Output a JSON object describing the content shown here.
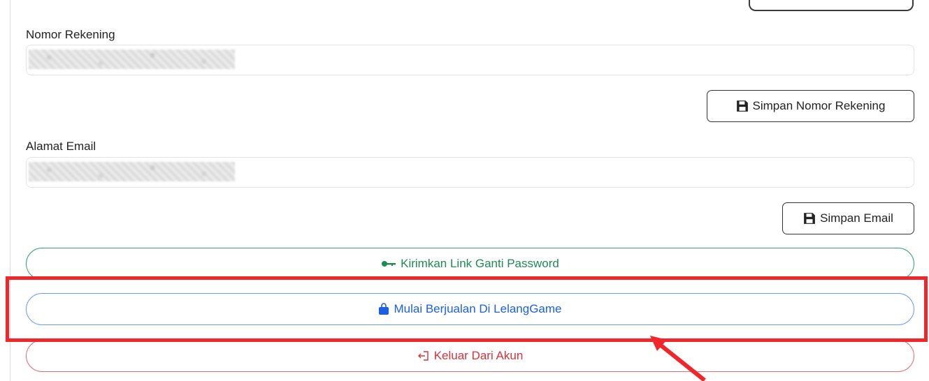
{
  "account_number": {
    "label": "Nomor Rekening",
    "save_label": "Simpan Nomor Rekening"
  },
  "email": {
    "label": "Alamat Email",
    "save_label": "Simpan Email"
  },
  "actions": {
    "reset_password": "Kirimkan Link Ganti Password",
    "start_selling": "Mulai Berjualan Di LelangGame",
    "logout": "Keluar Dari Akun"
  },
  "icons": {
    "save": "floppy-disk-icon",
    "key": "key-icon",
    "shop": "shopping-bag-icon",
    "logout": "sign-out-icon"
  },
  "colors": {
    "success": "#1f8a54",
    "primary": "#1a5fe6",
    "danger": "#d9323c",
    "annotation": "#f0262a"
  }
}
